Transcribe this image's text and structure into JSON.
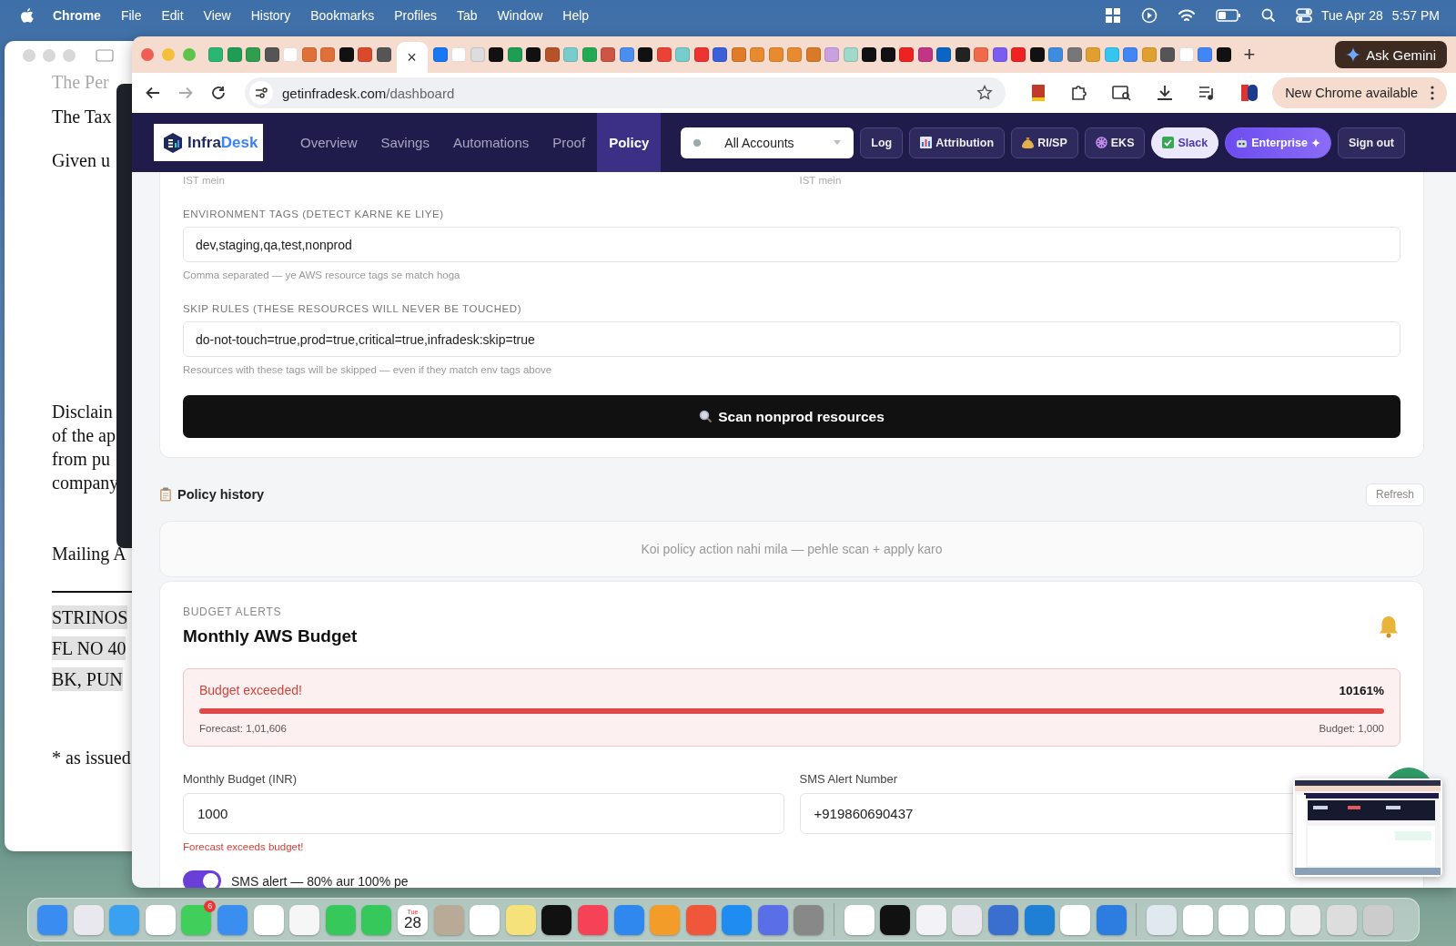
{
  "menu_bar": {
    "app": "Chrome",
    "menus": [
      "File",
      "Edit",
      "View",
      "History",
      "Bookmarks",
      "Profiles",
      "Tab",
      "Window",
      "Help"
    ],
    "date": "Tue Apr 28",
    "time": "5:57 PM"
  },
  "background_document": {
    "lines": [
      {
        "text": "The Per",
        "highlighted": false
      },
      {
        "text": "The Tax",
        "highlighted": false
      },
      {
        "text": "Given u",
        "highlighted": false
      },
      {
        "text": "Disclain",
        "highlighted": false
      },
      {
        "text": "of the ap",
        "highlighted": false
      },
      {
        "text": "from pu",
        "highlighted": false
      },
      {
        "text": "company",
        "highlighted": false
      },
      {
        "text": "Mailing A",
        "highlighted": false
      },
      {
        "text": "STRINOS",
        "highlighted": true
      },
      {
        "text": "FL NO 40",
        "highlighted": true
      },
      {
        "text": "BK, PUN",
        "highlighted": true
      },
      {
        "text": "* as issued",
        "highlighted": false
      }
    ]
  },
  "browser": {
    "active_tab_close": "×",
    "new_tab": "+",
    "gemini_button": "Ask Gemini",
    "forward_disabled": true,
    "url": {
      "host": "getinfradesk.com",
      "path": "/dashboard"
    },
    "update_button": "New Chrome available"
  },
  "navbar": {
    "logo": {
      "first": "Infra",
      "second": "Desk"
    },
    "tabs": [
      {
        "label": "Overview",
        "selected": false
      },
      {
        "label": "Savings",
        "selected": false
      },
      {
        "label": "Automations",
        "selected": false
      },
      {
        "label": "Proof",
        "selected": false
      },
      {
        "label": "Policy",
        "selected": true
      }
    ],
    "account_select": {
      "value": "All Accounts"
    },
    "buttons": [
      {
        "label": "Log",
        "kind": "plain"
      },
      {
        "label": "Attribution",
        "kind": "plain"
      },
      {
        "label": "RI/SP",
        "kind": "plain"
      },
      {
        "label": "EKS",
        "kind": "plain"
      },
      {
        "label": "Slack",
        "kind": "light"
      },
      {
        "label": "Enterprise",
        "kind": "accent"
      },
      {
        "label": "Sign out",
        "kind": "plain"
      }
    ]
  },
  "policy": {
    "hints_top": [
      "IST mein",
      "IST mein"
    ],
    "fields": [
      {
        "label": "ENVIRONMENT TAGS (DETECT KARNE KE LIYE)",
        "value": "dev,staging,qa,test,nonprod",
        "hint": "Comma separated — ye AWS resource tags se match hoga"
      },
      {
        "label": "SKIP RULES (THESE RESOURCES WILL NEVER BE TOUCHED)",
        "value": "do-not-touch=true,prod=true,critical=true,infradesk:skip=true",
        "hint": "Resources with these tags will be skipped — even if they match env tags above"
      }
    ],
    "scan_button": "Scan nonprod resources"
  },
  "policy_history": {
    "title": "Policy history",
    "refresh_button": "Refresh",
    "empty_message": "Koi policy action nahi mila — pehle scan + apply karo"
  },
  "budget": {
    "eyebrow": "BUDGET ALERTS",
    "title": "Monthly AWS Budget",
    "alert": {
      "title": "Budget exceeded!",
      "percent": "10161%",
      "level": 1,
      "forecast": "Forecast: 1,01,606",
      "budget": "Budget: 1,000"
    },
    "fields": [
      {
        "label": "Monthly Budget (INR)",
        "value": "1000",
        "error": "Forecast exceeds budget!"
      },
      {
        "label": "SMS Alert Number",
        "value": "+919860690437"
      }
    ],
    "sms_toggle": {
      "label": "SMS alert — 80% aur 100% pe",
      "on": true
    }
  },
  "dock": {
    "messages_badge": "6",
    "calendar_month": "Tue",
    "calendar_day": "28"
  }
}
